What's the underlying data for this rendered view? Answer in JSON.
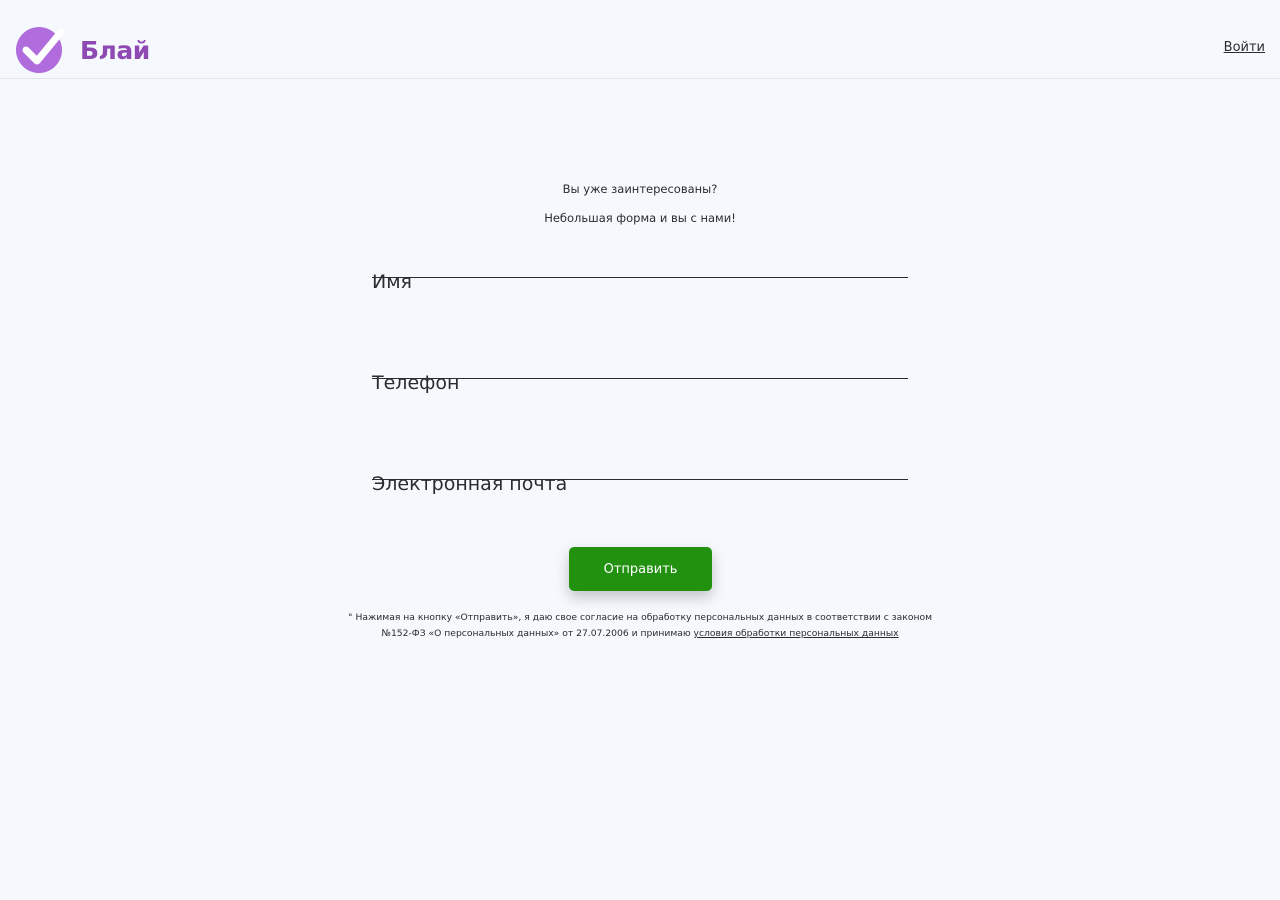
{
  "header": {
    "brand": "Блай",
    "login_label": "Войти",
    "brand_color": "#8e49b2",
    "logo_icon": "check-circle-icon"
  },
  "intro": {
    "line1": "Вы уже заинтересованы?",
    "line2": "Небольшая форма и вы с нами!"
  },
  "form": {
    "name_placeholder": "Имя",
    "phone_placeholder": "Телефон",
    "email_placeholder": "Электронная почта",
    "submit_label": "Отправить",
    "submit_color": "#22910f"
  },
  "consent": {
    "text": "° Нажимая на кнопку «Отправить», я даю свое согласие на обработку персональных данных в соответствии с законом №152-ФЗ «О персональных данных» от 27.07.2006 и принимаю",
    "link_label": "условия обработки персональных данных"
  }
}
